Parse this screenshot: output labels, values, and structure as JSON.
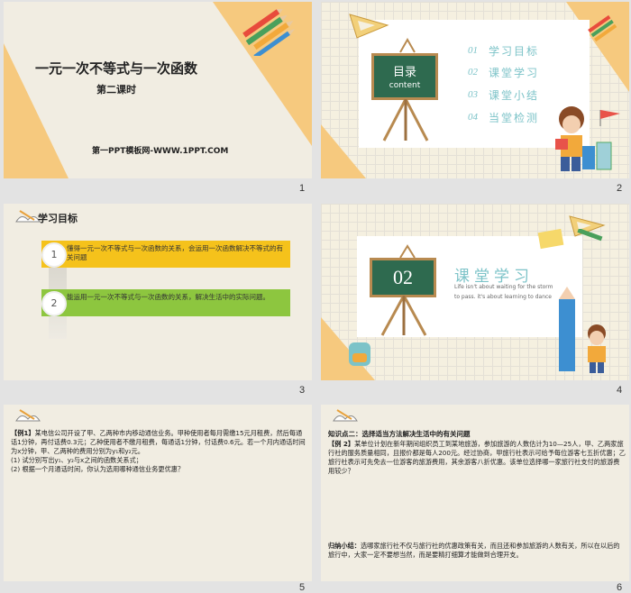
{
  "slides": [
    {
      "number": "1",
      "title": "一元一次不等式与一次函数",
      "subtitle": "第二课时",
      "site": "第一PPT模板网-WWW.1PPT.COM"
    },
    {
      "number": "2",
      "board_title": "目录",
      "board_subtitle": "content",
      "toc": [
        {
          "num": "01",
          "label": "学习目标"
        },
        {
          "num": "02",
          "label": "课堂学习"
        },
        {
          "num": "03",
          "label": "课堂小结"
        },
        {
          "num": "04",
          "label": "当堂检测"
        }
      ]
    },
    {
      "number": "3",
      "header": "学习目标",
      "goals": [
        {
          "num": "1",
          "text": "懂得一元一次不等式与一次函数的关系，会运用一次函数解决不等式的有关问题"
        },
        {
          "num": "2",
          "text": "能运用一元一次不等式与一次函数的关系，解决生活中的实际问题。"
        }
      ]
    },
    {
      "number": "4",
      "board_num": "02",
      "label": "课堂学习",
      "quote_line1": "Life isn't about waiting for the storm",
      "quote_line2": "to pass. it's about learning to dance"
    },
    {
      "number": "5",
      "example_tag": "【例1】",
      "example_text": "某电信公司开设了甲、乙两种市内移动通信业务。甲种使用者每月需缴15元月租费，然后每通话1分钟，再付话费0.3元；乙种使用者不缴月租费，每通话1分钟，付话费0.6元。若一个月内通话时间为x分钟，甲、乙两种的费用分别为y₁和y₂元。",
      "q1": "(1) 试分别写出y₁、y₂与x之间的函数关系式；",
      "q2": "(2) 根据一个月通话时间，你认为选用哪种通信业务更优惠？"
    },
    {
      "number": "6",
      "point_title": "知识点二：选择适当方法解决生活中的有关问题",
      "example_tag": "【例 2】",
      "example_text": "某单位计划在新年期间组织员工到某地旅游，参加旅游的人数估计为10—25人，甲、乙两家旅行社的服务质量相同，且报价都是每人200元。经过协商，甲旅行社表示可给予每位游客七五折优惠；乙旅行社表示可先免去一位游客的旅游费用，其余游客八折优惠。该单位选择哪一家旅行社支付的旅游费用较少？",
      "summary_tag": "归纳小结：",
      "summary_text": "选哪家旅行社不仅与旅行社的优惠政策有关，而且还和参加旅游的人数有关，所以在以后的旅行中，大家一定不要想当然，而是要精打细算才能做到合理开支。"
    }
  ],
  "colors": {
    "accent_yellow": "#f6c97e",
    "teal": "#7cc3c8",
    "board_green": "#2e6a4f",
    "goal1": "#f5c21b",
    "goal2": "#8dc63f"
  }
}
